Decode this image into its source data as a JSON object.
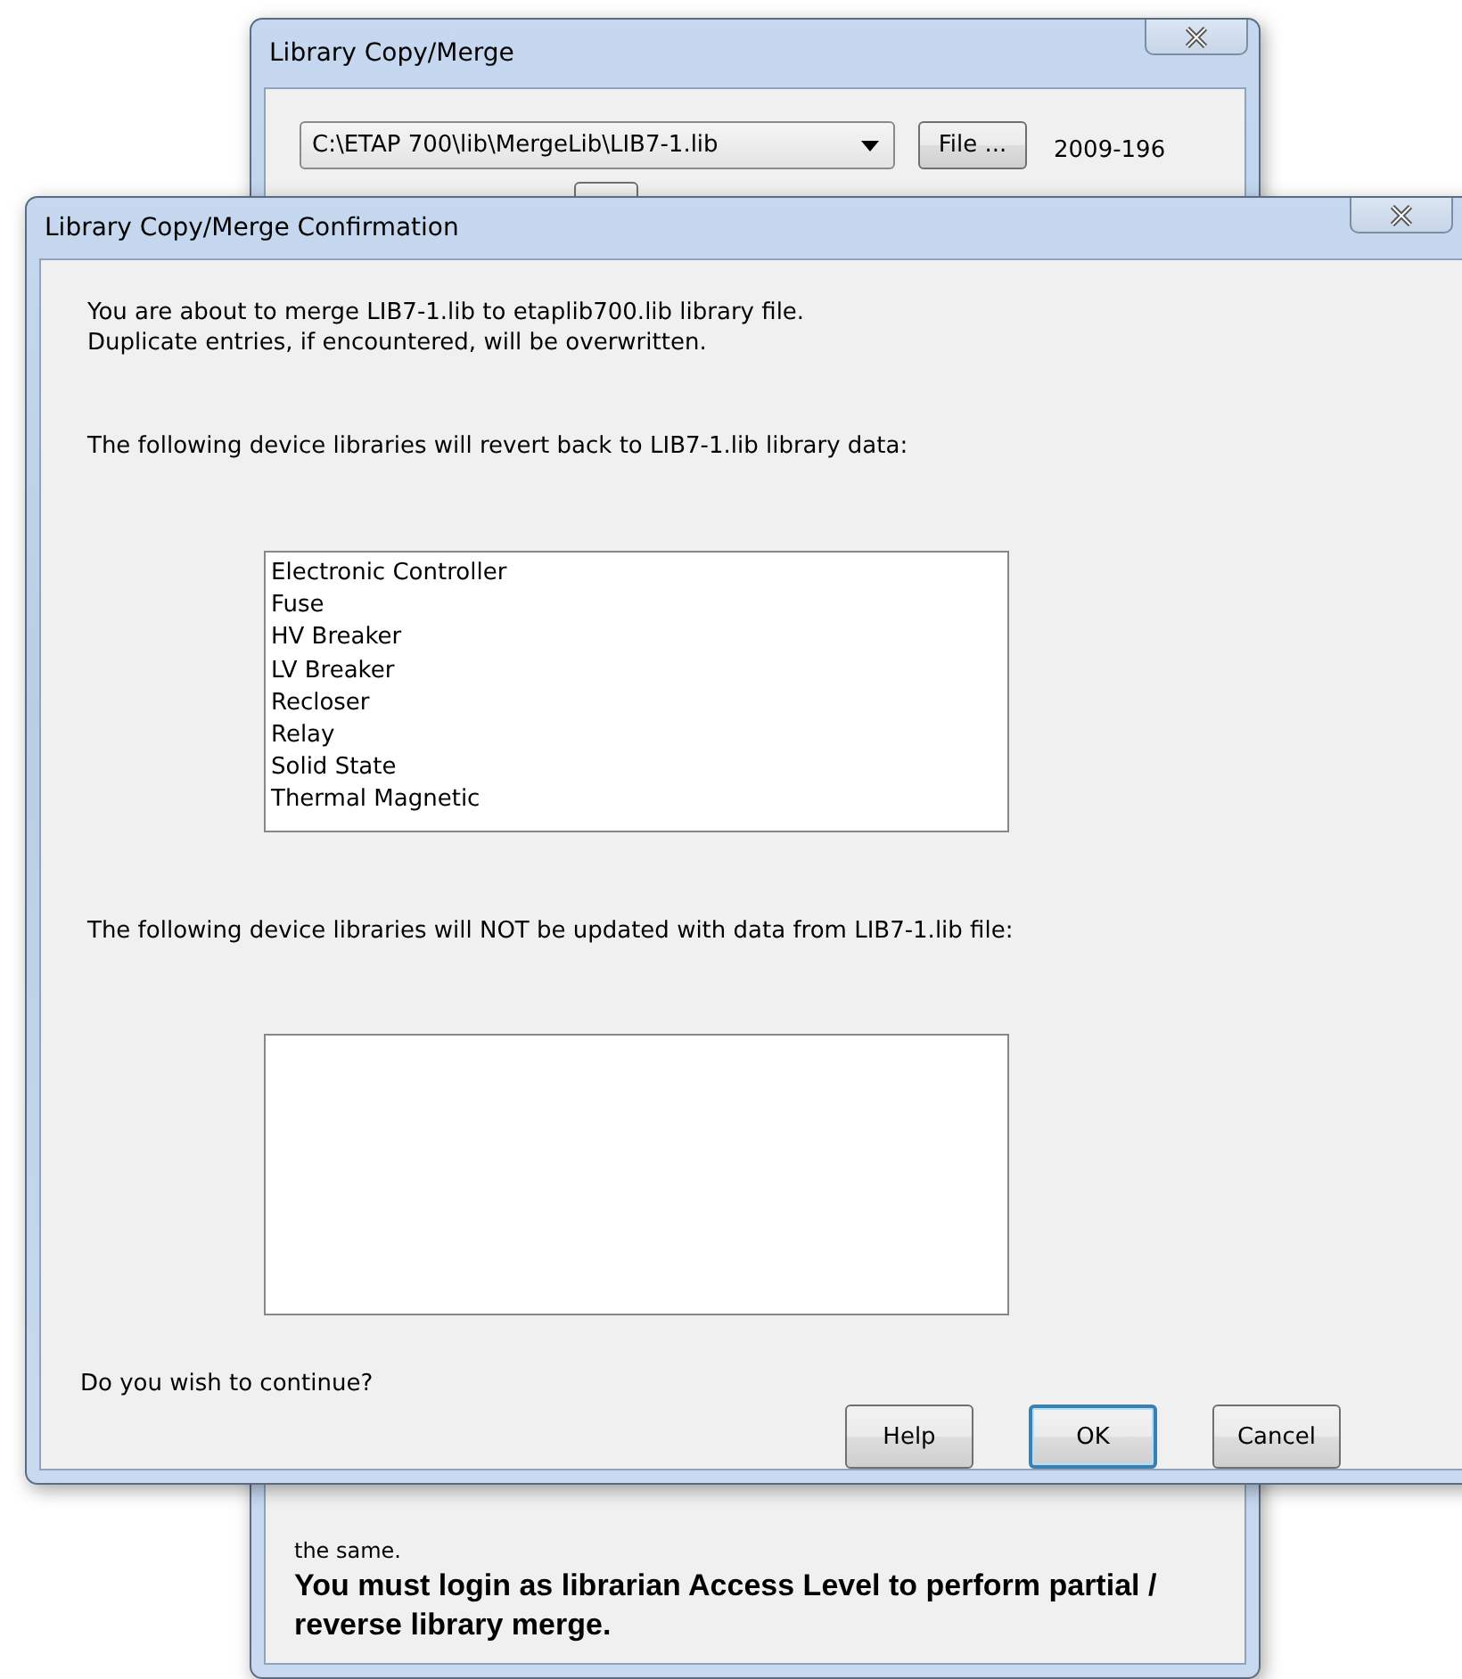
{
  "background_window": {
    "title": "Library Copy/Merge",
    "library_path": "C:\\ETAP 700\\lib\\MergeLib\\LIB7-1.lib",
    "file_button": "File ...",
    "header": "2009-196",
    "warning_tail": "the same.",
    "login_note": "You must login as librarian Access Level to perform partial / reverse library merge."
  },
  "dialog": {
    "title": "Library Copy/Merge Confirmation",
    "message": [
      "You are about to merge LIB7-1.lib to etaplib700.lib library file.",
      "Duplicate entries, if encountered, will be overwritten."
    ],
    "revert_label": "The following device libraries will revert back to LIB7-1.lib library data:",
    "revert_list": [
      "Electronic Controller",
      "Fuse",
      "HV Breaker",
      "LV Breaker",
      "Recloser",
      "Relay",
      "Solid State",
      "Thermal Magnetic"
    ],
    "not_updated_label": "The following device libraries will NOT be updated with data from LIB7-1.lib file:",
    "question": "Do you wish to continue?",
    "buttons": [
      {
        "label": "Help",
        "default": false
      },
      {
        "label": "OK",
        "default": true
      },
      {
        "label": "Cancel",
        "default": false
      }
    ]
  }
}
